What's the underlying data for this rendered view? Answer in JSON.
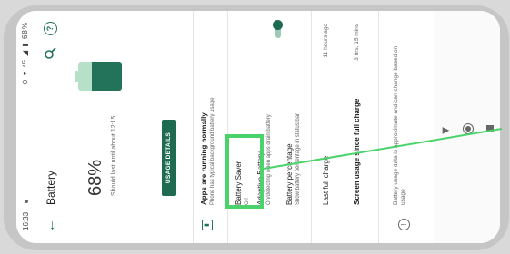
{
  "status_bar": {
    "time": "16:33",
    "icons": "⊖ ▾ ⁴ᴳ ◢ ▮ 68%"
  },
  "app_bar": {
    "title": "Battery"
  },
  "summary": {
    "percentage": "68%",
    "level": 0.68,
    "estimate": "Should last until about 12:15",
    "usage_button": "USAGE DETAILS"
  },
  "tip": {
    "title": "Apps are running normally",
    "subtitle": "Phone has typical background battery usage"
  },
  "settings": {
    "battery_saver": {
      "title": "Battery Saver",
      "state": "Off"
    },
    "adaptive": {
      "title": "Adaptive Battery",
      "subtitle": "On/detecting when apps drain battery"
    },
    "percentage": {
      "title": "Battery percentage",
      "subtitle": "Show battery percentage in status bar",
      "enabled": true
    },
    "last_full": {
      "title": "Last full charge",
      "value": "11 hours ago"
    },
    "screen_usage": {
      "title": "Screen usage since full charge",
      "value": "3 hrs, 15 mins"
    }
  },
  "footer": {
    "note": "Battery usage data is approximate and can change based on usage"
  },
  "colors": {
    "accent": "#23735a",
    "highlight": "#4ad36a"
  }
}
